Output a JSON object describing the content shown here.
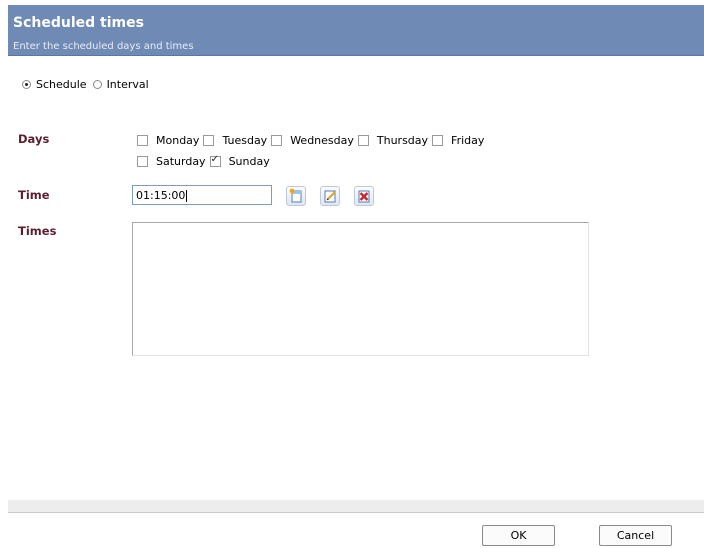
{
  "header": {
    "title": "Scheduled times",
    "subtitle": "Enter the scheduled days and times"
  },
  "mode": {
    "options": [
      {
        "label": "Schedule",
        "selected": true
      },
      {
        "label": "Interval",
        "selected": false
      }
    ]
  },
  "days": {
    "label": "Days",
    "row1": [
      {
        "label": "Monday",
        "checked": false
      },
      {
        "label": "Tuesday",
        "checked": false
      },
      {
        "label": "Wednesday",
        "checked": false
      },
      {
        "label": "Thursday",
        "checked": false
      },
      {
        "label": "Friday",
        "checked": false
      }
    ],
    "row2": [
      {
        "label": "Saturday",
        "checked": false
      },
      {
        "label": "Sunday",
        "checked": true
      }
    ]
  },
  "time": {
    "label": "Time",
    "value": "01:15:00",
    "buttons": [
      "add-time-icon",
      "edit-time-icon",
      "delete-time-icon"
    ]
  },
  "times": {
    "label": "Times",
    "items": []
  },
  "footer": {
    "ok_label": "OK",
    "cancel_label": "Cancel"
  },
  "colors": {
    "header_bg": "#6f8bb5",
    "label_color": "#5a1f2f"
  }
}
